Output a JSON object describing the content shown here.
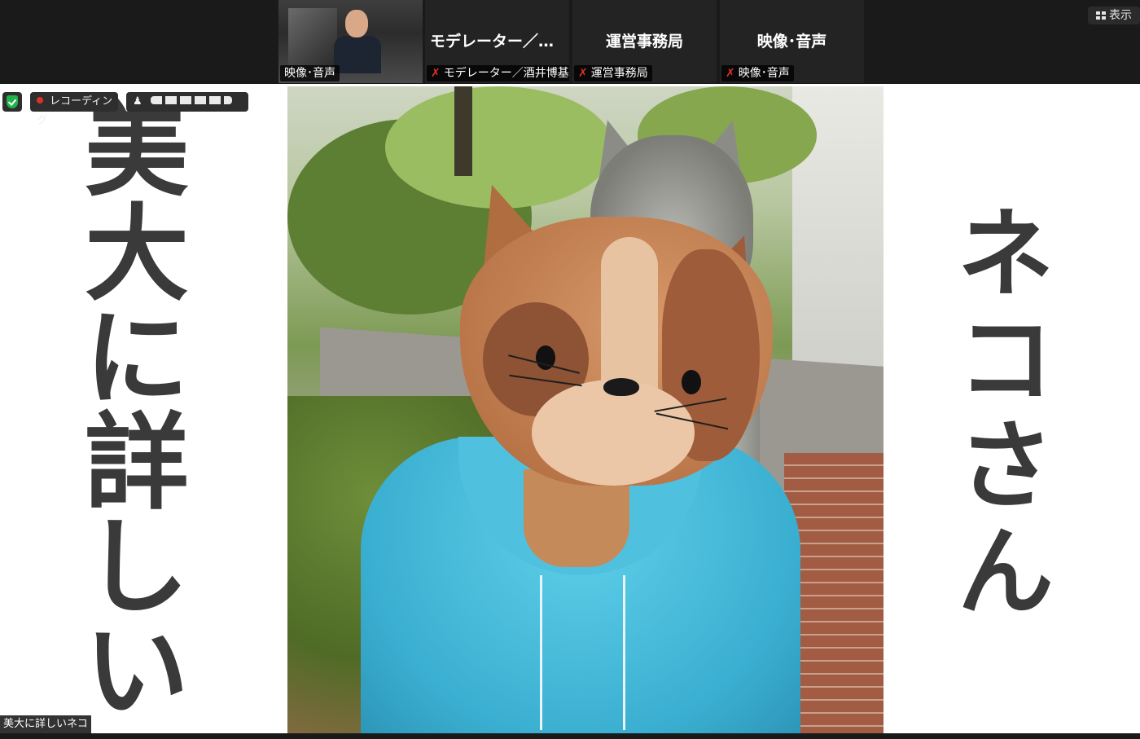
{
  "top_strip": {
    "video_tile": {
      "label": "映像･音声"
    },
    "tiles": [
      {
        "name": "モデレーター／酒…",
        "label": "モデレーター／酒井博基"
      },
      {
        "name": "運営事務局",
        "label": "運営事務局"
      },
      {
        "name": "映像･音声",
        "label": "映像･音声"
      }
    ],
    "view_button": "表示"
  },
  "overlay": {
    "recording": "レコーディング"
  },
  "main_video": {
    "left_caption": [
      "美",
      "大",
      "に",
      "詳",
      "し",
      "い"
    ],
    "right_caption": [
      "ネ",
      "コ",
      "さ",
      "ん"
    ]
  },
  "speaker_name": "美大に詳しいネコ",
  "colors": {
    "hoodie": "#4fc1df",
    "recording_dot": "#e0302c",
    "shield": "#22b24c",
    "mic_muted": "#e0302c"
  }
}
